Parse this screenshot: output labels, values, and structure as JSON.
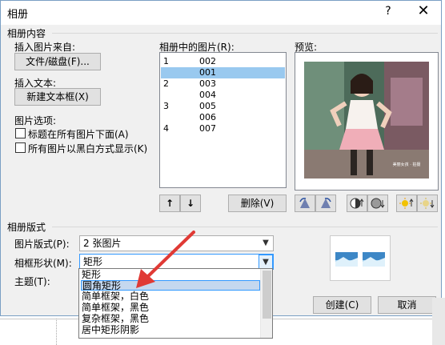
{
  "window": {
    "title": "相册",
    "help": "?",
    "close": "✕"
  },
  "content_group": {
    "label": "相册内容",
    "insert_from_label": "插入图片来自:",
    "file_button": "文件/磁盘(F)...",
    "insert_text_label": "插入文本:",
    "new_textbox_button": "新建文本框(X)",
    "options_label": "图片选项:",
    "caption_checkbox": {
      "label": "标题在所有图片下面(A)",
      "checked": false
    },
    "bw_checkbox": {
      "label": "所有图片以黑白方式显示(K)",
      "checked": false
    }
  },
  "pictures_list": {
    "label": "相册中的图片(R):",
    "rows": [
      {
        "num": "1",
        "name": "002",
        "selected": false
      },
      {
        "num": "",
        "name": "001",
        "selected": true
      },
      {
        "num": "2",
        "name": "003",
        "selected": false
      },
      {
        "num": "",
        "name": "004",
        "selected": false
      },
      {
        "num": "3",
        "name": "005",
        "selected": false
      },
      {
        "num": "",
        "name": "006",
        "selected": false
      },
      {
        "num": "4",
        "name": "007",
        "selected": false
      }
    ],
    "move_up": "↑",
    "move_down": "↓",
    "delete_button": "删除(V)"
  },
  "preview": {
    "label": "预览:",
    "watermark": "美丽女孩 · 拍摄"
  },
  "layout_group": {
    "label": "相册版式",
    "picture_layout_label": "图片版式(P):",
    "picture_layout_value": "2 张图片",
    "frame_shape_label": "相框形状(M):",
    "frame_shape_value": "矩形",
    "theme_label": "主题(T):",
    "frame_options": [
      "矩形",
      "圆角矩形",
      "简单框架，白色",
      "简单框架，黑色",
      "复杂框架，黑色",
      "居中矩形阴影"
    ],
    "highlighted_option_index": 1
  },
  "footer": {
    "create_button": "创建(C)",
    "cancel_button": "取消"
  },
  "colors": {
    "accent": "#3399ff",
    "selection": "#99c9ef",
    "arrow": "#e03a35"
  }
}
